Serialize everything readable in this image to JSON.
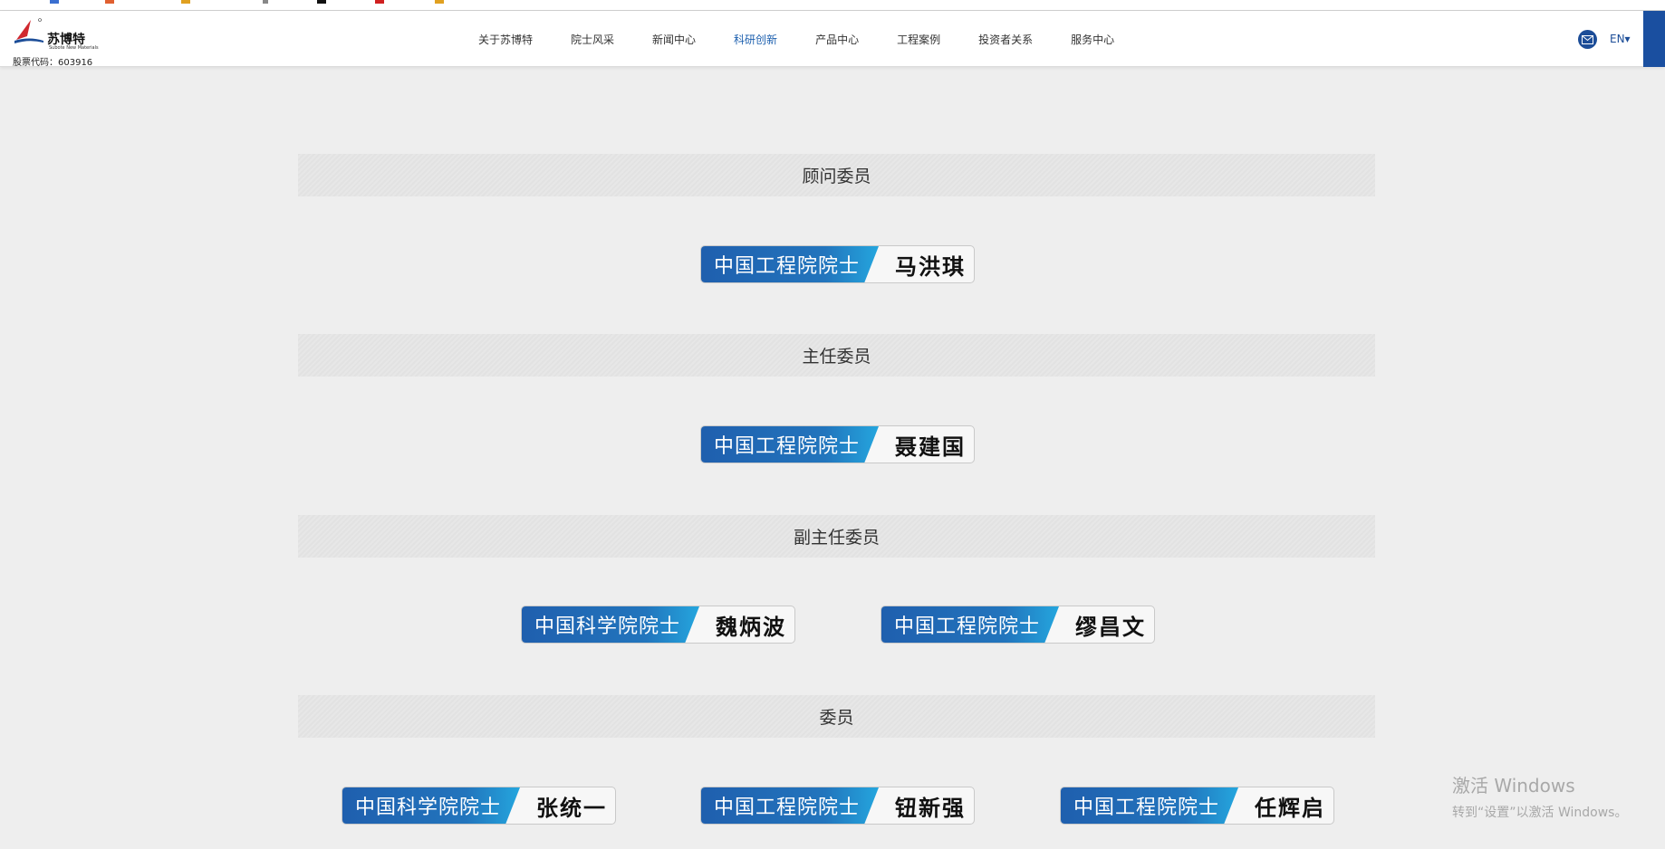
{
  "header": {
    "brand_name": "苏博特",
    "brand_sub": "Subote New Materials",
    "stock_code": "股票代码：603916",
    "nav": [
      "关于苏博特",
      "院士风采",
      "新闻中心",
      "科研创新",
      "产品中心",
      "工程案例",
      "投资者关系",
      "服务中心"
    ],
    "active_nav": "科研创新",
    "language": "EN▾"
  },
  "sections": [
    {
      "title": "顾问委员",
      "members": [
        {
          "org": "中国工程院院士",
          "name": "马洪琪"
        }
      ]
    },
    {
      "title": "主任委员",
      "members": [
        {
          "org": "中国工程院院士",
          "name": "聂建国"
        }
      ]
    },
    {
      "title": "副主任委员",
      "members": [
        {
          "org": "中国科学院院士",
          "name": "魏炳波"
        },
        {
          "org": "中国工程院院士",
          "name": "缪昌文"
        }
      ]
    },
    {
      "title": "委员",
      "members": [
        {
          "org": "中国科学院院士",
          "name": "张统一"
        },
        {
          "org": "中国工程院院士",
          "name": "钮新强"
        },
        {
          "org": "中国工程院院士",
          "name": "任辉启"
        }
      ]
    }
  ],
  "watermark": {
    "line1": "激活 Windows",
    "line2": "转到“设置”以激活 Windows。"
  },
  "colors": {
    "brand_blue": "#1c5fae",
    "badge_gradient_start": "#1f5fae",
    "badge_gradient_end": "#24a6de",
    "page_bg": "#eeeeee"
  }
}
